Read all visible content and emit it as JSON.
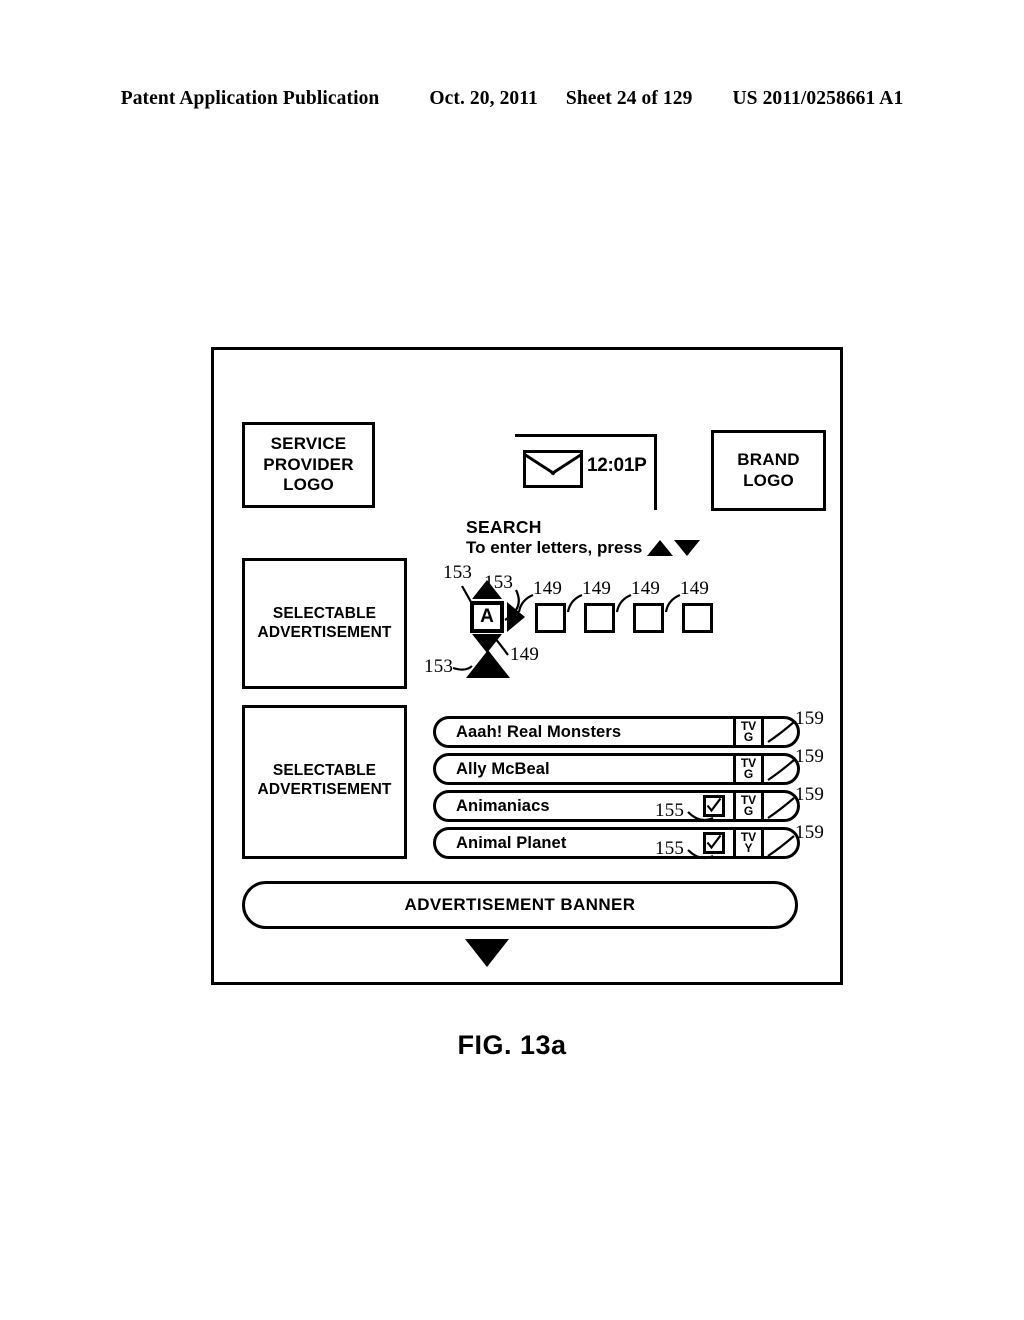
{
  "page_header": {
    "publication": "Patent Application Publication",
    "date": "Oct. 20, 2011",
    "sheet": "Sheet 24 of 129",
    "patent_number": "US 2011/0258661 A1"
  },
  "figure": {
    "caption": "FIG. 13a"
  },
  "screen": {
    "service_provider_logo": "SERVICE PROVIDER LOGO",
    "brand_logo": "BRAND LOGO",
    "status_bar": {
      "mail_icon": "envelope-icon",
      "time": "12:01P"
    },
    "search": {
      "title": "SEARCH",
      "hint": "To enter letters, press",
      "hint_icons": [
        "triangle-up-icon",
        "triangle-down-icon"
      ],
      "active_letter": "A",
      "empty_cells": [
        "",
        "",
        "",
        ""
      ]
    },
    "advertisements": {
      "selectable_1": "SELECTABLE ADVERTISEMENT",
      "selectable_2": "SELECTABLE ADVERTISEMENT",
      "banner": "ADVERTISEMENT BANNER"
    },
    "program_list": [
      {
        "title": "Aaah! Real Monsters",
        "rating_line1": "TV",
        "rating_line2": "G",
        "checked": false
      },
      {
        "title": "Ally McBeal",
        "rating_line1": "TV",
        "rating_line2": "G",
        "checked": false
      },
      {
        "title": "Animaniacs",
        "rating_line1": "TV",
        "rating_line2": "G",
        "checked": true
      },
      {
        "title": "Animal Planet",
        "rating_line1": "TV",
        "rating_line2": "Y",
        "checked": true
      }
    ]
  },
  "reference_numerals": {
    "n153_a": "153",
    "n153_b": "153",
    "n153_c": "153",
    "n149_cursor": "149",
    "n149_0": "149",
    "n149_1": "149",
    "n149_2": "149",
    "n149_3": "149",
    "n155_a": "155",
    "n155_b": "155",
    "n159_0": "159",
    "n159_1": "159",
    "n159_2": "159",
    "n159_3": "159"
  }
}
